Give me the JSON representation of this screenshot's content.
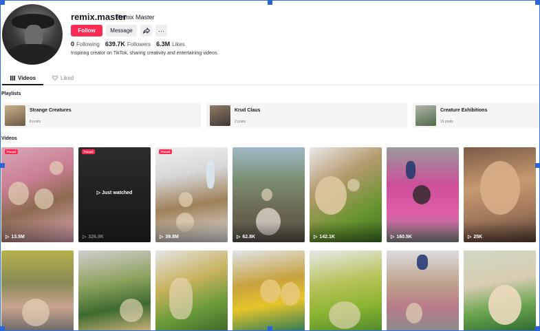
{
  "profile": {
    "username": "remix.master",
    "display_name": "Remix Master",
    "follow_label": "Follow",
    "message_label": "Message",
    "stats": [
      {
        "value": "0",
        "label": "Following"
      },
      {
        "value": "639.7K",
        "label": "Followers"
      },
      {
        "value": "6.3M",
        "label": "Likes"
      }
    ],
    "bio": "Inspiring creator on TikTok, sharing creativity and entertaining videos."
  },
  "tabs": {
    "videos_label": "Videos",
    "liked_label": "Liked",
    "active": "Videos"
  },
  "playlists": {
    "heading": "Playlists",
    "items": [
      {
        "title": "Strange Creatures",
        "count": "8 posts"
      },
      {
        "title": "Krud Claus",
        "count": "2 posts"
      },
      {
        "title": "Creature Exhibitions",
        "count": "16 posts"
      }
    ]
  },
  "videos": {
    "heading": "Videos",
    "pinned_label": "Pinned",
    "watched_label": "Just watched",
    "row1": [
      {
        "views": "13.5M",
        "pinned": true
      },
      {
        "views": "326.9K",
        "pinned": true,
        "just_watched": true
      },
      {
        "views": "39.8M",
        "pinned": true
      },
      {
        "views": "62.8K"
      },
      {
        "views": "142.1K"
      },
      {
        "views": "160.5K"
      },
      {
        "views": "25K"
      }
    ]
  },
  "colors": {
    "accent": "#fe2c55",
    "text": "#161823",
    "muted": "#8a8b91",
    "selection": "#2a64d6"
  },
  "icons": [
    "share-icon",
    "more-icon",
    "grid-icon",
    "heart-icon",
    "play-icon"
  ]
}
